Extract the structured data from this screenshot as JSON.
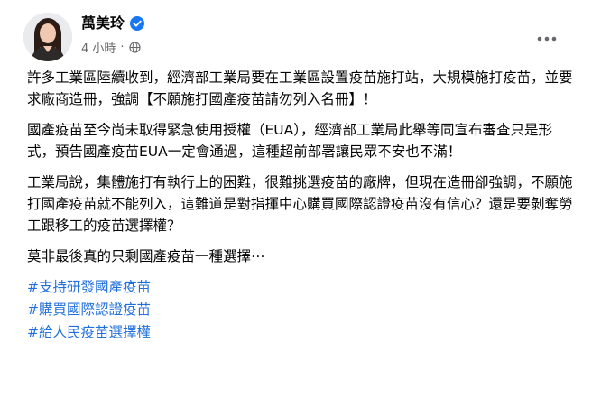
{
  "post": {
    "author_name": "萬美玲",
    "timestamp": "4 小時",
    "meta_separator": "·",
    "paragraphs": [
      "許多工業區陸續收到，經濟部工業局要在工業區設置疫苗施打站，大規模施打疫苗，並要求廠商造冊，強調【不願施打國產疫苗請勿列入名冊】！",
      "國產疫苗至今尚未取得緊急使用授權（EUA），經濟部工業局此舉等同宣布審查只是形式，預告國產疫苗EUA一定會通過，這種超前部署讓民眾不安也不滿！",
      "工業局說，￼集體施打有執行上的困難，很難挑選疫苗的廠牌，但現在造冊卻強調，不願施打國產疫苗就不能列入，這難道是對指揮中心購買國際認證疫苗沒有信心？還是要剝奪勞工跟移工的疫苗選擇權？￼￼",
      "莫非最後真的只剩國產疫苗一種選擇⋯"
    ],
    "hashtags": [
      "#支持研發國產疫苗",
      "#購買國際認證疫苗",
      "#給人民疫苗選擇權"
    ]
  },
  "colors": {
    "text": "#050505",
    "secondary": "#65676b",
    "link": "#216fdb",
    "verified": "#1877f2"
  },
  "icons": {
    "verified": "verified-badge-icon",
    "audience": "globe-icon",
    "more": "more-options-icon"
  }
}
